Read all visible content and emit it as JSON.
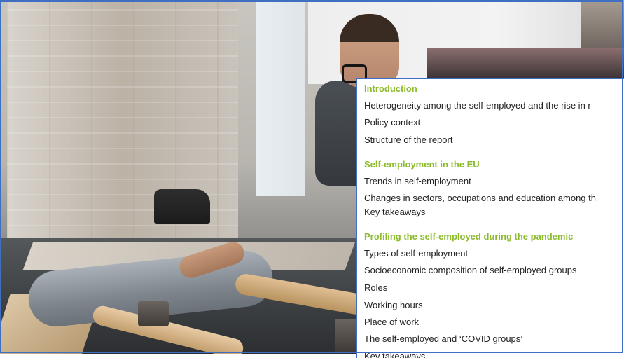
{
  "toc": {
    "sections": [
      {
        "title": "Introduction",
        "items": [
          "Heterogeneity among the self-employed and the rise in r",
          "Policy context",
          "Structure of the report"
        ]
      },
      {
        "title": "Self-employment in the EU",
        "items": [
          "Trends in self-employment",
          "Changes in sectors, occupations and education among th",
          "Key takeaways"
        ]
      },
      {
        "title": "Profiling the self-employed during the pandemic",
        "items": [
          "Types of self-employment",
          "Socioeconomic composition of self-employed groups",
          "Roles",
          "Working hours",
          "Place of work",
          "The self-employed and ‘COVID groups’",
          "Key takeaways"
        ]
      }
    ]
  },
  "colors": {
    "section_title": "#8dbb2e",
    "frame": "#3f6fc2"
  }
}
